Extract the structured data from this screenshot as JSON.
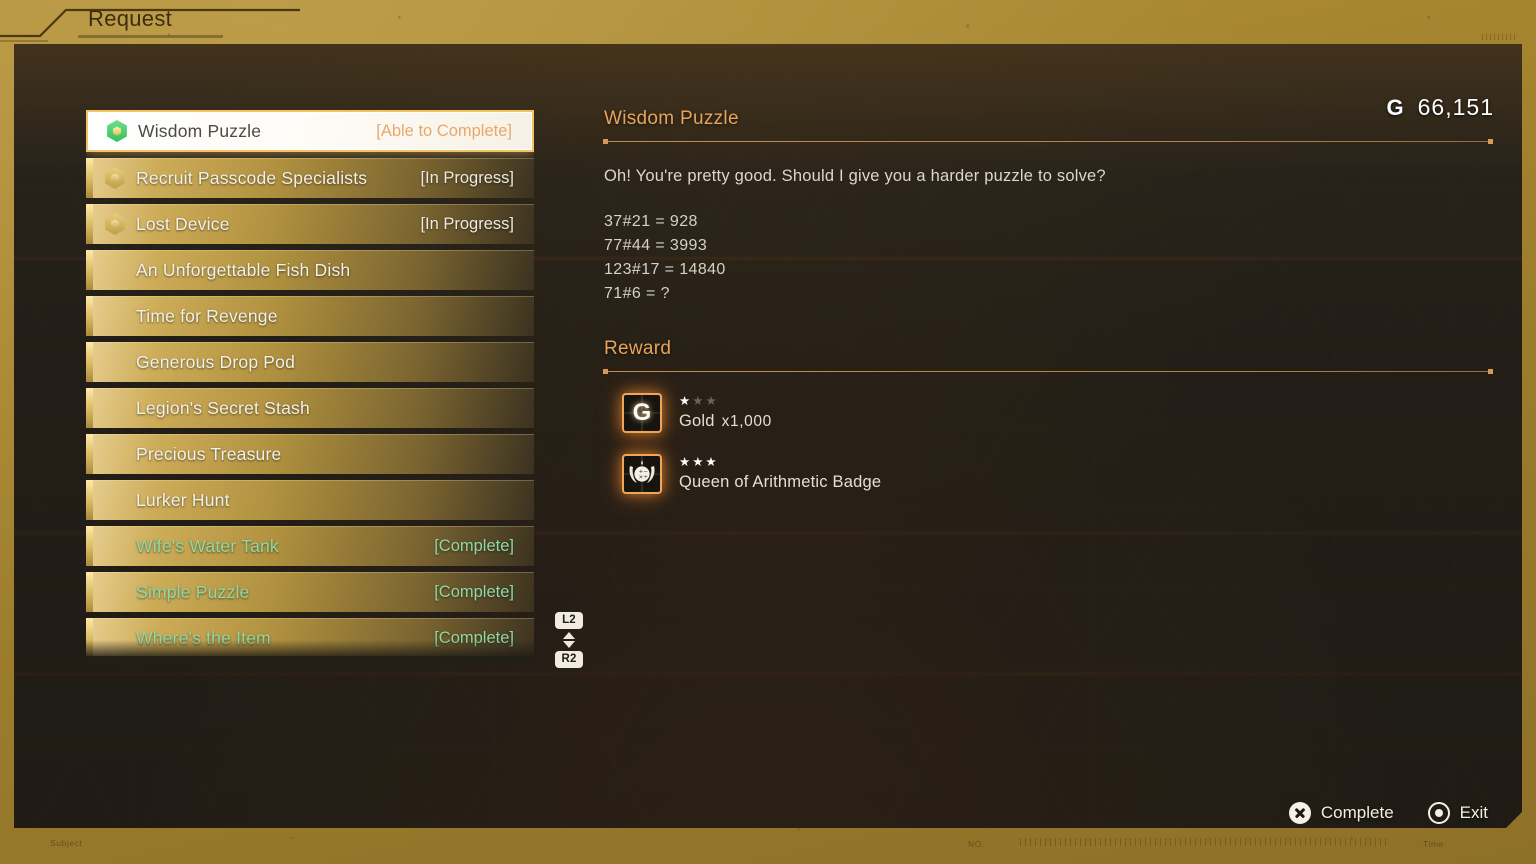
{
  "frame": {
    "title": "Request",
    "micro_labels": {
      "subject": "Subject",
      "no": "NO.",
      "time": "Time"
    }
  },
  "currency": {
    "symbol": "G",
    "amount": "66,151"
  },
  "quest_list": {
    "scroll_hint": {
      "up_button": "L2",
      "down_button": "R2"
    },
    "items": [
      {
        "title": "Wisdom Puzzle",
        "status": "[Able to Complete]",
        "icon": "hexagon-icon-green",
        "state": "selected"
      },
      {
        "title": "Recruit Passcode Specialists",
        "status": "[In Progress]",
        "icon": "hexagon-icon-gold",
        "state": "in-progress"
      },
      {
        "title": "Lost Device",
        "status": "[In Progress]",
        "icon": "hexagon-icon-gold",
        "state": "in-progress"
      },
      {
        "title": "An Unforgettable Fish Dish",
        "status": "",
        "icon": "",
        "state": "available"
      },
      {
        "title": "Time for Revenge",
        "status": "",
        "icon": "",
        "state": "available"
      },
      {
        "title": "Generous Drop Pod",
        "status": "",
        "icon": "",
        "state": "available"
      },
      {
        "title": "Legion's Secret Stash",
        "status": "",
        "icon": "",
        "state": "available"
      },
      {
        "title": "Precious Treasure",
        "status": "",
        "icon": "",
        "state": "available"
      },
      {
        "title": "Lurker Hunt",
        "status": "",
        "icon": "",
        "state": "available"
      },
      {
        "title": "Wife's Water Tank",
        "status": "[Complete]",
        "icon": "",
        "state": "complete"
      },
      {
        "title": "Simple Puzzle",
        "status": "[Complete]",
        "icon": "",
        "state": "complete"
      },
      {
        "title": "Where's the Item",
        "status": "[Complete]",
        "icon": "",
        "state": "complete"
      }
    ]
  },
  "detail": {
    "title": "Wisdom Puzzle",
    "description": "Oh! You're pretty good. Should I give you a harder puzzle to solve?",
    "puzzle_lines": [
      "37#21 = 928",
      "77#44 = 3993",
      "123#17 = 14840",
      "71#6 = ?"
    ],
    "reward_heading": "Reward",
    "rewards": [
      {
        "name": "Gold",
        "quantity": "x1,000",
        "rarity_filled": 1,
        "rarity_total": 3,
        "icon": "gold-coin-icon"
      },
      {
        "name": "Queen of Arithmetic Badge",
        "quantity": "",
        "rarity_filled": 3,
        "rarity_total": 3,
        "icon": "arithmetic-badge-icon"
      }
    ]
  },
  "footer": {
    "prompts": [
      {
        "label": "Complete",
        "button": "cross-button-icon"
      },
      {
        "label": "Exit",
        "button": "circle-button-icon"
      }
    ]
  },
  "colors": {
    "frame_gold": "#a5842f",
    "panel_dark": "#221e17",
    "accent_orange": "#e8a35a",
    "complete_green": "#8fd9a6",
    "row_gold": "#cdac58",
    "selected_bg": "#ffffff"
  }
}
